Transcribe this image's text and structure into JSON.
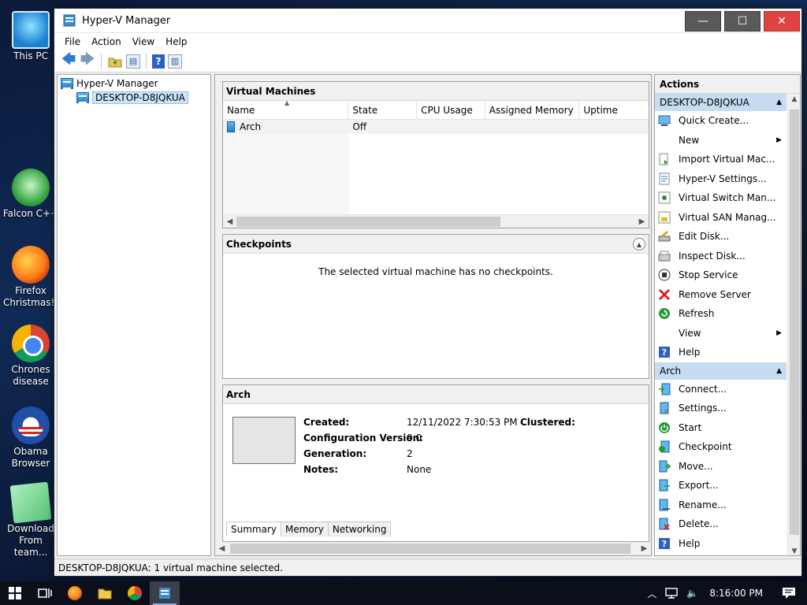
{
  "desktop": {
    "icons": [
      {
        "label": "This PC"
      },
      {
        "label": "Falcon C++"
      },
      {
        "label": "Firefox Christmas!!"
      },
      {
        "label": "Chrones disease"
      },
      {
        "label": "Obama Browser"
      },
      {
        "label": "Download From team..."
      }
    ]
  },
  "window": {
    "title": "Hyper-V Manager",
    "controls": {
      "minimize": "—",
      "maximize": "☐",
      "close": "✕"
    }
  },
  "menubar": [
    "File",
    "Action",
    "View",
    "Help"
  ],
  "toolbar": {
    "back": "🡄",
    "forward": "🡆",
    "help": "?"
  },
  "tree": {
    "root": "Hyper-V Manager",
    "child": "DESKTOP-D8JQKUA"
  },
  "vm_panel": {
    "title": "Virtual Machines",
    "columns": [
      "Name",
      "State",
      "CPU Usage",
      "Assigned Memory",
      "Uptime"
    ],
    "rows": [
      {
        "name": "Arch",
        "state": "Off",
        "cpu": "",
        "memory": "",
        "uptime": ""
      }
    ]
  },
  "checkpoints": {
    "title": "Checkpoints",
    "message": "The selected virtual machine has no checkpoints."
  },
  "summary": {
    "title": "Arch",
    "fields": [
      {
        "label": "Created:",
        "value": "12/11/2022 7:30:53 PM"
      },
      {
        "label": "Configuration Version:",
        "value": "9.0"
      },
      {
        "label": "Generation:",
        "value": "2"
      },
      {
        "label": "Notes:",
        "value": "None"
      }
    ],
    "clustered_label": "Clustered:",
    "tabs": [
      "Summary",
      "Memory",
      "Networking"
    ]
  },
  "actions": {
    "title": "Actions",
    "groups": [
      {
        "name": "DESKTOP-D8JQKUA",
        "items": [
          {
            "label": "Quick Create...",
            "icon": "quick-create-icon"
          },
          {
            "label": "New",
            "icon": "none",
            "submenu": true
          },
          {
            "label": "Import Virtual Mac...",
            "icon": "import-icon"
          },
          {
            "label": "Hyper-V Settings...",
            "icon": "settings-icon"
          },
          {
            "label": "Virtual Switch Man...",
            "icon": "switch-icon"
          },
          {
            "label": "Virtual SAN Manag...",
            "icon": "san-icon"
          },
          {
            "label": "Edit Disk...",
            "icon": "edit-disk-icon"
          },
          {
            "label": "Inspect Disk...",
            "icon": "inspect-disk-icon"
          },
          {
            "label": "Stop Service",
            "icon": "stop-icon"
          },
          {
            "label": "Remove Server",
            "icon": "remove-icon"
          },
          {
            "label": "Refresh",
            "icon": "refresh-icon"
          },
          {
            "label": "View",
            "icon": "none",
            "submenu": true
          },
          {
            "label": "Help",
            "icon": "help-icon"
          }
        ]
      },
      {
        "name": "Arch",
        "items": [
          {
            "label": "Connect...",
            "icon": "connect-icon"
          },
          {
            "label": "Settings...",
            "icon": "vm-settings-icon"
          },
          {
            "label": "Start",
            "icon": "start-icon"
          },
          {
            "label": "Checkpoint",
            "icon": "checkpoint-icon"
          },
          {
            "label": "Move...",
            "icon": "move-icon"
          },
          {
            "label": "Export...",
            "icon": "export-icon"
          },
          {
            "label": "Rename...",
            "icon": "rename-icon"
          },
          {
            "label": "Delete...",
            "icon": "delete-icon"
          },
          {
            "label": "Help",
            "icon": "help-icon"
          }
        ]
      }
    ]
  },
  "statusbar": {
    "text": "DESKTOP-D8JQKUA:  1 virtual machine selected."
  },
  "taskbar": {
    "clock": "8:16:00 PM"
  }
}
